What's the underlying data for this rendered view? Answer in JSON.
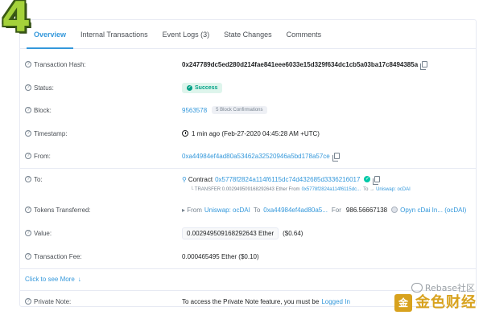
{
  "step_number": "4",
  "tabs": [
    {
      "label": "Overview"
    },
    {
      "label": "Internal Transactions"
    },
    {
      "label": "Event Logs (3)"
    },
    {
      "label": "State Changes"
    },
    {
      "label": "Comments"
    }
  ],
  "rows": {
    "hash": {
      "label": "Transaction Hash:",
      "value": "0x247789dc5ed280d214fae841eee6033e15d329f634dc1cb5a03ba17c8494385a"
    },
    "status": {
      "label": "Status:",
      "value": "Success"
    },
    "block": {
      "label": "Block:",
      "value": "9563578",
      "confirmations": "5 Block Confirmations"
    },
    "timestamp": {
      "label": "Timestamp:",
      "value": "1 min ago (Feb-27-2020 04:45:28 AM +UTC)"
    },
    "from": {
      "label": "From:",
      "value": "0xa44984ef4ad80a53462a32520946a5bd178a57ce"
    },
    "to": {
      "label": "To:",
      "prefix": "Contract",
      "value": "0x5778f2824a114f6115dc74d432685d3336216017",
      "sub_transfer": "└ TRANSFER  0.002949509168292643 Ether From",
      "sub_from": "0x5778f2824a114f6115dc...",
      "sub_to_word": "To →",
      "sub_to": "Uniswap: ocDAI"
    },
    "tokens": {
      "label": "Tokens Transferred:",
      "from_word": "▸ From",
      "from": "Uniswap: ocDAI",
      "to_word": "To",
      "to": "0xa44984ef4ad80a5...",
      "for_word": "For",
      "amount": "986.56667138",
      "token": "Opyn cDai In... (ocDAI)"
    },
    "value": {
      "label": "Value:",
      "value": "0.002949509168292643 Ether",
      "usd": "($0.64)"
    },
    "fee": {
      "label": "Transaction Fee:",
      "value": "0.000465495 Ether ($0.10)"
    },
    "more": {
      "label": "Click to see More",
      "arrow": "↓"
    },
    "note": {
      "label": "Private Note:",
      "text": "To access the Private Note feature, you must be",
      "link": "Logged In"
    }
  },
  "watermark": {
    "top": "Rebase社区",
    "bottom": "金色财经",
    "logo": "金"
  },
  "colors": {
    "link": "#3498db",
    "success": "#00a186",
    "accent_number": "#a4d23a"
  }
}
